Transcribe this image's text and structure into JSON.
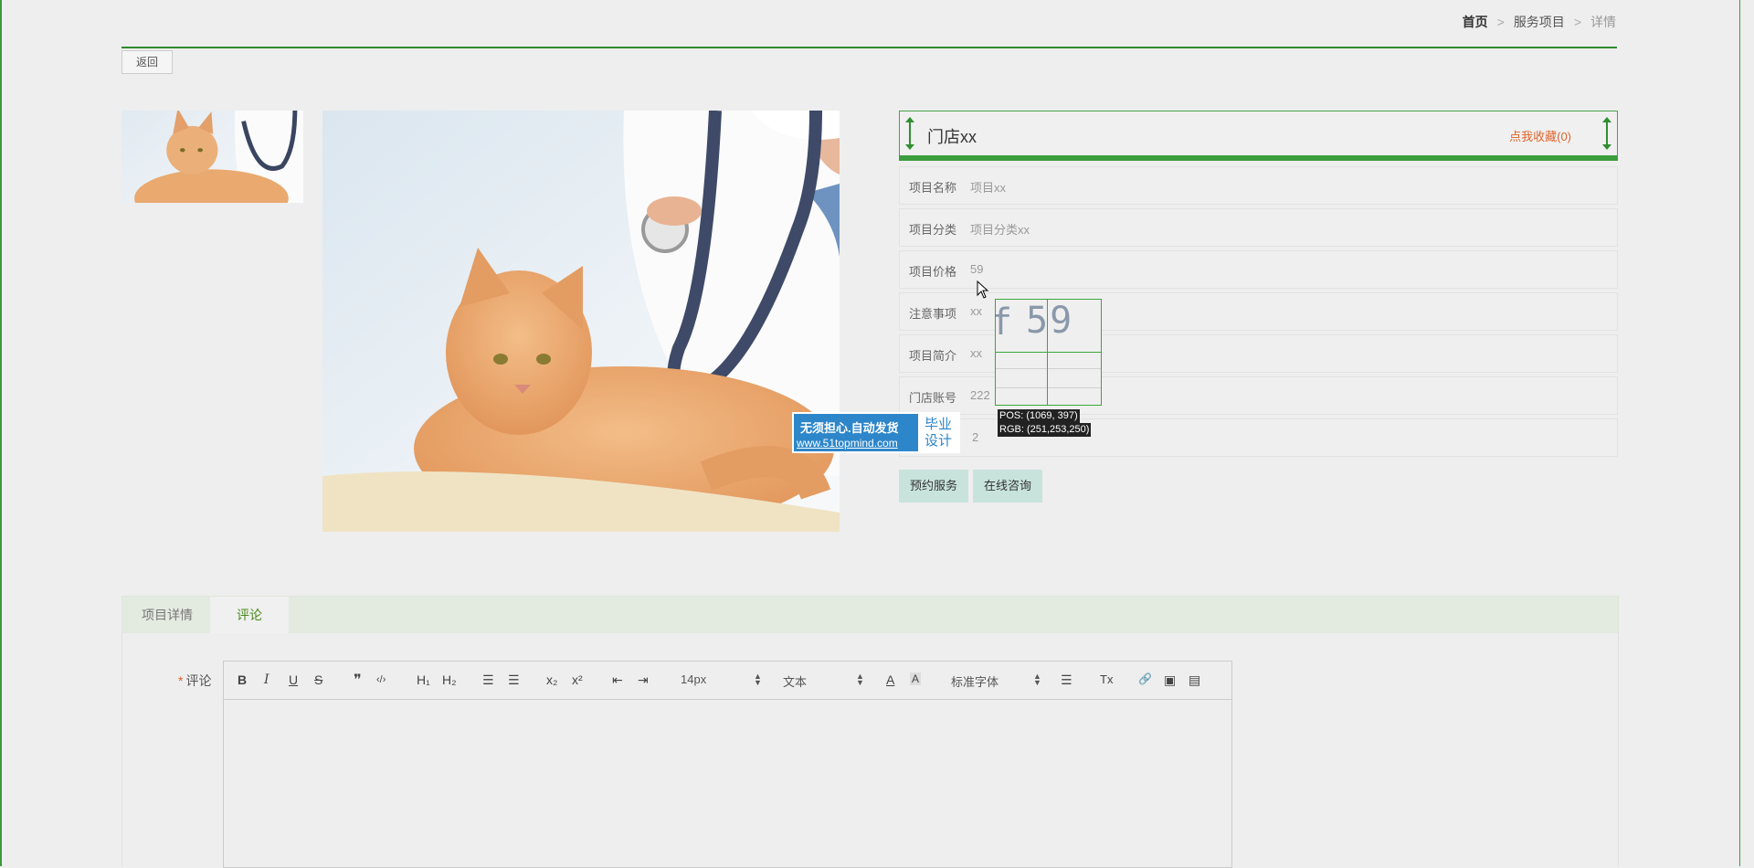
{
  "breadcrumb": {
    "home": "首页",
    "section": "服务项目",
    "current": "详情",
    "sep": ">"
  },
  "back_label": "返回",
  "store": {
    "name": "门店xx",
    "favorite_label": "点我收藏(0)"
  },
  "details": [
    {
      "label": "项目名称",
      "value": "项目xx"
    },
    {
      "label": "项目分类",
      "value": "项目分类xx"
    },
    {
      "label": "项目价格",
      "value": "59"
    },
    {
      "label": "注意事项",
      "value": "xx"
    },
    {
      "label": "项目简介",
      "value": "xx"
    },
    {
      "label": "门店账号",
      "value": "222"
    },
    {
      "label": "",
      "value": "2"
    }
  ],
  "buttons": {
    "book": "预约服务",
    "consult": "在线咨询"
  },
  "watermark": {
    "line1": "无须担心.自动发货",
    "line2": "www.51topmind.com",
    "badge1": "毕业",
    "badge2": "设计"
  },
  "magnifier": {
    "zoom_text": "59",
    "zoom_left": "f",
    "pos": "POS: (1069, 397)",
    "rgb": "RGB: (251,253,250)"
  },
  "tabs": {
    "details": "项目详情",
    "comments": "评论"
  },
  "comment": {
    "required": "*",
    "label": "评论"
  },
  "editor": {
    "bold": "B",
    "italic": "I",
    "underline": "U",
    "strike": "S",
    "quote": "❞",
    "code": "‹/›",
    "h1": "H₁",
    "h2": "H₂",
    "ol": "☰",
    "ul": "☰",
    "sub": "x₂",
    "sup": "x²",
    "outdent": "⇤",
    "indent": "⇥",
    "size": "14px",
    "para": "文本",
    "font": "标准字体",
    "color": "A",
    "bg": "A",
    "align": "☰",
    "clean": "Tx",
    "link": "🔗",
    "image": "▣",
    "video": "▤"
  },
  "colors": {
    "accent_green": "#3c9d3c",
    "favorite": "#e0632a",
    "button_bg": "#c8e3dc"
  }
}
